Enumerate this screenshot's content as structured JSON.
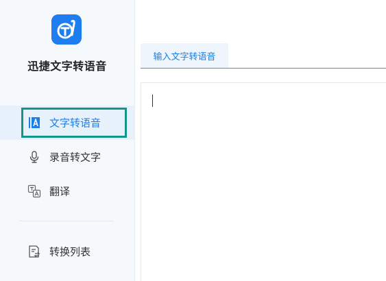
{
  "app": {
    "name": "迅捷文字转语音",
    "accent_color": "#1e7ef0",
    "highlight_color": "#13958a"
  },
  "sidebar": {
    "items": [
      {
        "label": "文字转语音",
        "icon": "text-a-icon",
        "active": true
      },
      {
        "label": "录音转文字",
        "icon": "microphone-icon",
        "active": false
      },
      {
        "label": "翻译",
        "icon": "translate-icon",
        "active": false
      },
      {
        "label": "转换列表",
        "icon": "list-document-icon",
        "active": false
      }
    ]
  },
  "main": {
    "tabs": [
      {
        "label": "输入文字转语音",
        "active": true
      }
    ],
    "editor": {
      "value": ""
    }
  }
}
